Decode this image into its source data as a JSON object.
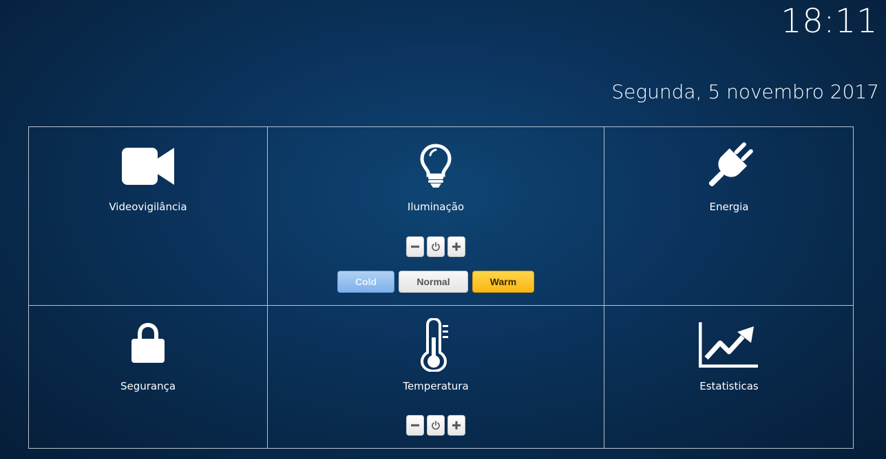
{
  "header": {
    "time": "18:11",
    "date": "Segunda, 5 novembro 2017"
  },
  "tiles": {
    "video": {
      "label": "Videovigilância",
      "icon": "video-camera-icon"
    },
    "light": {
      "label": "Iluminação",
      "icon": "light-bulb-icon",
      "controls": {
        "minus": "−",
        "power": "power-icon",
        "plus": "+"
      },
      "modes": [
        "Cold",
        "Normal",
        "Warm"
      ],
      "selected_mode": "Warm"
    },
    "energy": {
      "label": "Energia",
      "icon": "plug-icon"
    },
    "security": {
      "label": "Segurança",
      "icon": "lock-icon"
    },
    "temperature": {
      "label": "Temperatura",
      "icon": "thermometer-icon",
      "controls": {
        "minus": "−",
        "power": "power-icon",
        "plus": "+"
      }
    },
    "stats": {
      "label": "Estatisticas",
      "icon": "line-chart-icon"
    }
  },
  "colors": {
    "background": "#0b3560",
    "grid_line": "#b9c3cf",
    "cold": "#7fb1ea",
    "warm": "#fbb613"
  }
}
